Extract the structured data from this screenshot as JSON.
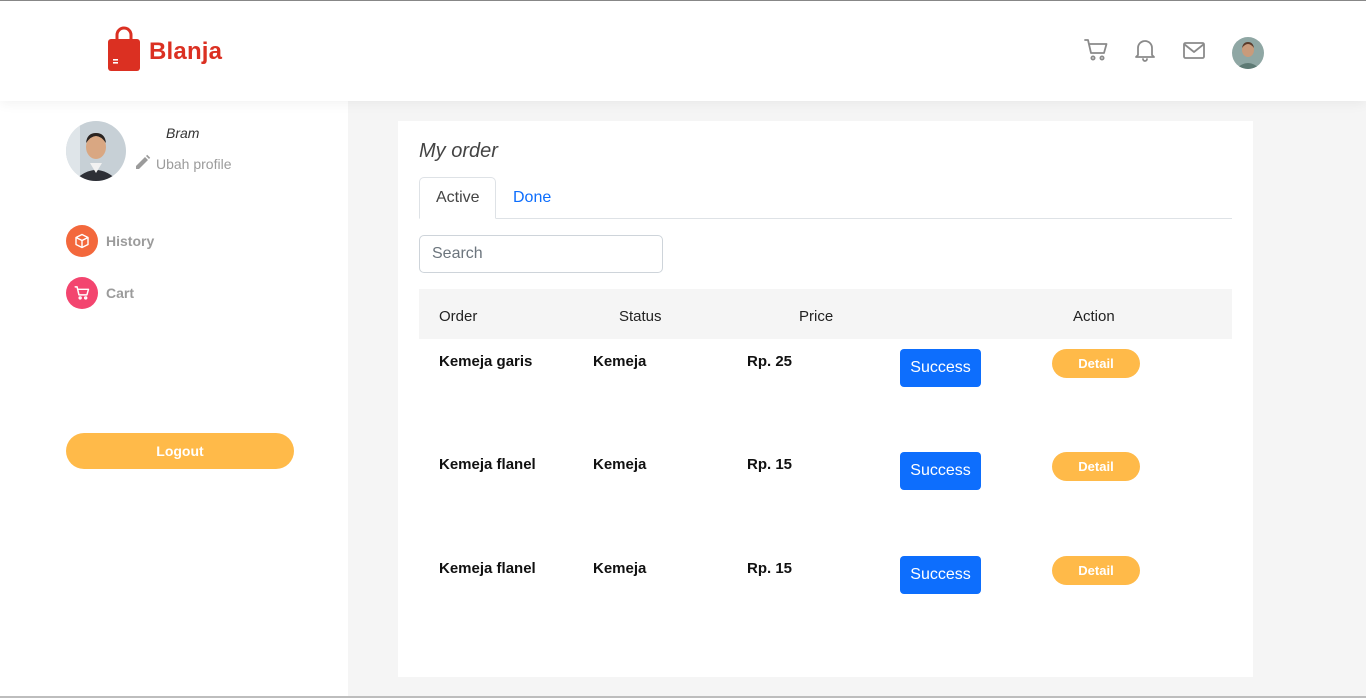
{
  "app": {
    "brand": "Blanja"
  },
  "colors": {
    "brand": "#db3022",
    "accent": "#ffba49",
    "primary": "#0d6efd",
    "history_icon_bg": "#f3683c",
    "cart_icon_bg": "#f3456f"
  },
  "header": {
    "icons": [
      "cart-icon",
      "bell-icon",
      "mail-icon"
    ]
  },
  "sidebar": {
    "username": "Bram",
    "edit_label": "Ubah profile",
    "items": [
      {
        "label": "History",
        "icon": "box-icon"
      },
      {
        "label": "Cart",
        "icon": "cart-icon"
      }
    ],
    "logout_label": "Logout"
  },
  "main": {
    "title": "My order",
    "tabs": [
      {
        "label": "Active",
        "active": true
      },
      {
        "label": "Done",
        "active": false
      }
    ],
    "search_placeholder": "Search",
    "columns": [
      "Order",
      "Status",
      "Price",
      "Action"
    ],
    "rows": [
      {
        "order": "Kemeja garis",
        "status": "Kemeja",
        "price": "Rp. 25",
        "state": "Success",
        "action": "Detail"
      },
      {
        "order": "Kemeja flanel",
        "status": "Kemeja",
        "price": "Rp. 15",
        "state": "Success",
        "action": "Detail"
      },
      {
        "order": "Kemeja flanel",
        "status": "Kemeja",
        "price": "Rp. 15",
        "state": "Success",
        "action": "Detail"
      }
    ]
  }
}
